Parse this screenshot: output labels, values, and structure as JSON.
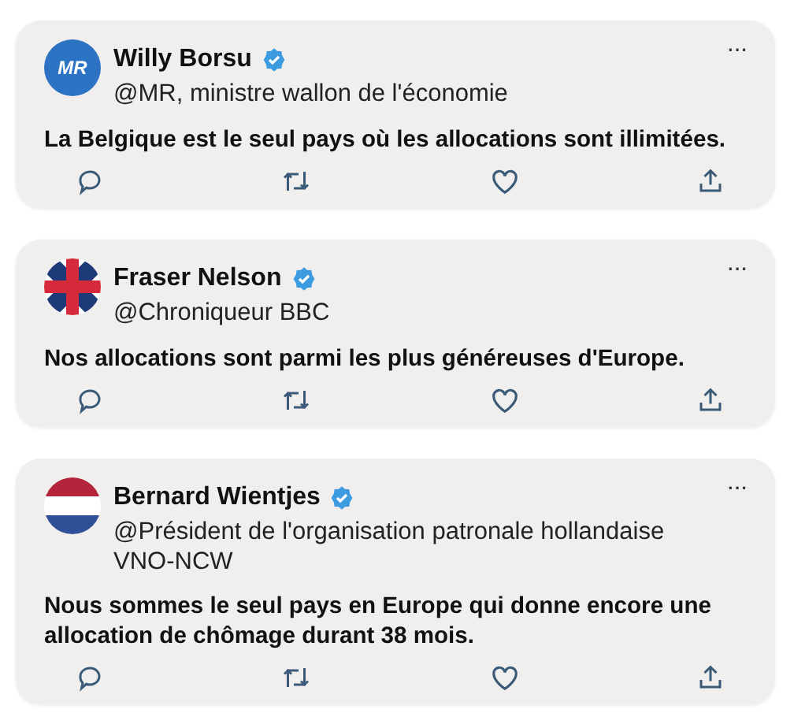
{
  "tweets": [
    {
      "avatar": {
        "kind": "party-logo",
        "text": "MR"
      },
      "name": "Willy Borsu",
      "verified": true,
      "handle": "@MR, ministre wallon de l'économie",
      "text": "La Belgique est le seul pays où les allocations sont illimitées.",
      "more": "···"
    },
    {
      "avatar": {
        "kind": "uk-flag"
      },
      "name": "Fraser Nelson",
      "verified": true,
      "handle": "@Chroniqueur BBC",
      "text": "Nos allocations sont parmi les plus généreuses d'Europe.",
      "more": "···"
    },
    {
      "avatar": {
        "kind": "nl-flag"
      },
      "name": "Bernard Wientjes",
      "verified": true,
      "handle": "@Président de l'organisation patronale hollandaise VNO-NCW",
      "text": "Nous sommes le seul pays en Europe qui donne encore une allocation de chômage durant 38 mois.",
      "more": "···"
    }
  ]
}
